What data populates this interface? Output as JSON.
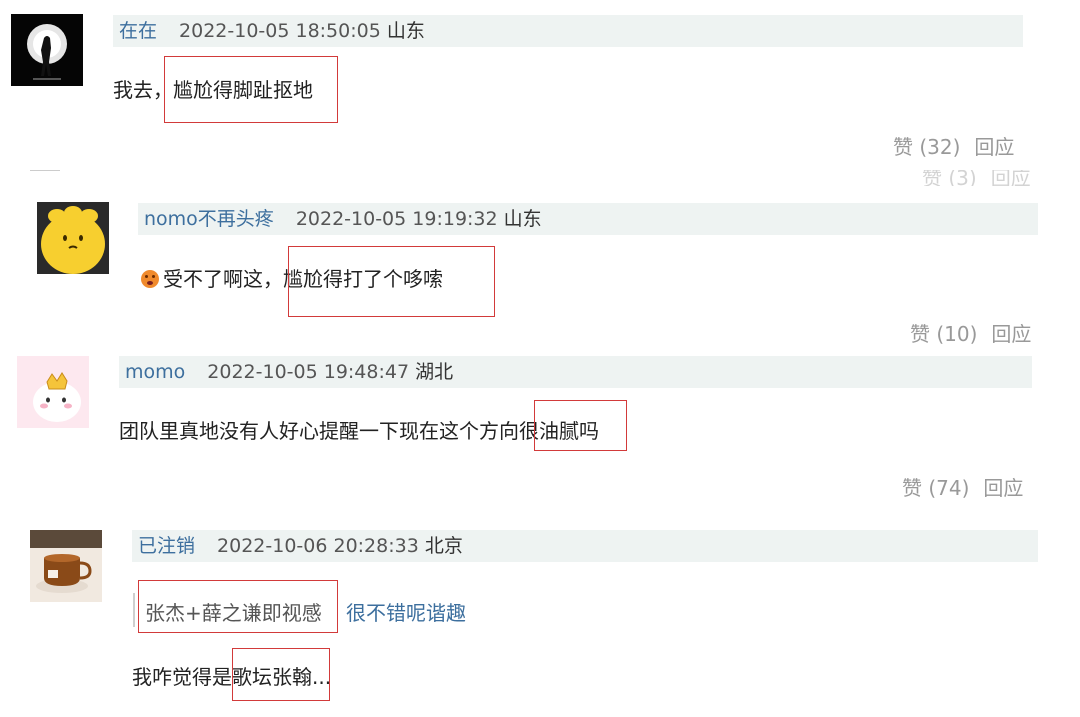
{
  "comments": [
    {
      "username": "在在",
      "time": "2022-10-05 18:50:05",
      "location": "山东",
      "text_prefix": "我去，",
      "text_highlight": "尴尬得脚趾抠地",
      "likes_label": "赞 (32)",
      "reply_label": "回应",
      "avatar": "silhouette-moon-icon"
    },
    {
      "username": "nomo不再头疼",
      "time": "2022-10-05 19:19:32",
      "location": "山东",
      "text_prefix": "受不了啊这，",
      "text_highlight": "尴尬得打了个哆嗦",
      "emoji": "dizzy-face-icon",
      "likes_label": "赞 (10)",
      "reply_label": "回应",
      "ghost_label": "赞 (3)",
      "avatar": "yellow-blob-icon"
    },
    {
      "username": "momo",
      "time": "2022-10-05 19:48:47",
      "location": "湖北",
      "text_prefix": "团队里真地没有人好心提醒一下现在这个方向",
      "text_highlight": "很油腻吗",
      "likes_label": "赞 (74)",
      "reply_label": "回应",
      "avatar": "pink-crown-icon"
    },
    {
      "username": "已注销",
      "time": "2022-10-06 20:28:33",
      "location": "北京",
      "quote": "张杰+薛之谦即视感",
      "quote_reply": "很不错呢谐趣",
      "text_prefix": "我咋觉得是",
      "text_highlight": "歌坛张翰",
      "text_suffix": "...",
      "avatar": "tea-cup-icon"
    }
  ],
  "ghost_reply": "回应"
}
